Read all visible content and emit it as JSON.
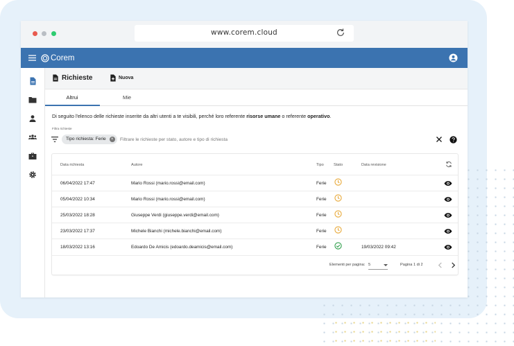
{
  "browser": {
    "url": "www.corem.cloud"
  },
  "appbar": {
    "logo_text": "Corem"
  },
  "toolbar": {
    "title": "Richieste",
    "new_label": "Nuova"
  },
  "tabs": [
    {
      "label": "Altrui"
    },
    {
      "label": "Mie"
    }
  ],
  "description": {
    "text_1": "Di seguito l'elenco delle richieste inserite da altri utenti a te visibili, perché loro referente ",
    "bold_1": "risorse umane",
    "text_2": " o referente ",
    "bold_2": "operativo",
    "text_3": "."
  },
  "filter": {
    "label": "Filtra richieste",
    "chip": "Tipo richiesta: Ferie",
    "placeholder": "Filtrare le richieste per stato, autore e tipo di richiesta"
  },
  "table": {
    "headers": [
      "Data richiesta",
      "Autore",
      "Tipo",
      "Stato",
      "Data revisione"
    ],
    "rows": [
      {
        "date": "06/04/2022 17:47",
        "author": "Mario Rossi (mario.rossi@email.com)",
        "type": "Ferie",
        "status": "pending",
        "review": ""
      },
      {
        "date": "05/04/2022 10:34",
        "author": "Mario Rossi (mario.rossi@email.com)",
        "type": "Ferie",
        "status": "pending",
        "review": ""
      },
      {
        "date": "25/03/2022 18:28",
        "author": "Giuseppe Verdi (giuseppe.verdi@email.com)",
        "type": "Ferie",
        "status": "pending",
        "review": ""
      },
      {
        "date": "23/03/2022 17:37",
        "author": "Michele Bianchi (michele.bianchi@email.com)",
        "type": "Ferie",
        "status": "pending",
        "review": ""
      },
      {
        "date": "18/03/2022 13:16",
        "author": "Edoardo De Amicis (edoardo.deamicis@email.com)",
        "type": "Ferie",
        "status": "approved",
        "review": "19/03/2022 09:42"
      }
    ]
  },
  "pagination": {
    "per_page_label": "Elementi per pagina:",
    "per_page_value": "5",
    "page_info": "Pagina 1 di 2"
  },
  "colors": {
    "primary": "#3b73b0",
    "pending": "#e8a93a",
    "approved": "#2e9e4a"
  }
}
